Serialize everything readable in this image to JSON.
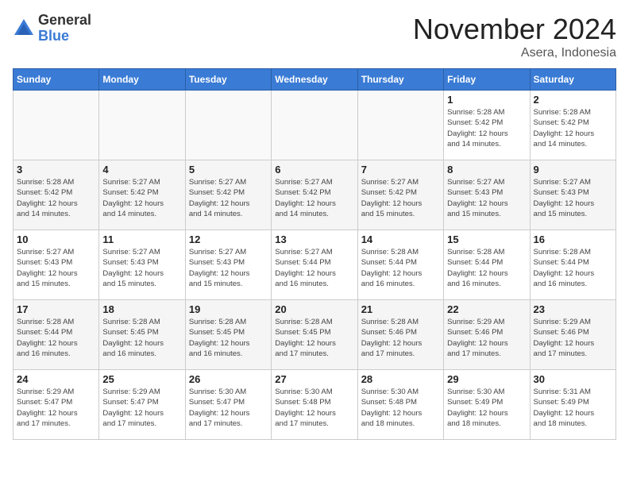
{
  "header": {
    "logo_general": "General",
    "logo_blue": "Blue",
    "month_title": "November 2024",
    "location": "Asera, Indonesia"
  },
  "days_of_week": [
    "Sunday",
    "Monday",
    "Tuesday",
    "Wednesday",
    "Thursday",
    "Friday",
    "Saturday"
  ],
  "weeks": [
    [
      {
        "day": "",
        "info": ""
      },
      {
        "day": "",
        "info": ""
      },
      {
        "day": "",
        "info": ""
      },
      {
        "day": "",
        "info": ""
      },
      {
        "day": "",
        "info": ""
      },
      {
        "day": "1",
        "info": "Sunrise: 5:28 AM\nSunset: 5:42 PM\nDaylight: 12 hours\nand 14 minutes."
      },
      {
        "day": "2",
        "info": "Sunrise: 5:28 AM\nSunset: 5:42 PM\nDaylight: 12 hours\nand 14 minutes."
      }
    ],
    [
      {
        "day": "3",
        "info": "Sunrise: 5:28 AM\nSunset: 5:42 PM\nDaylight: 12 hours\nand 14 minutes."
      },
      {
        "day": "4",
        "info": "Sunrise: 5:27 AM\nSunset: 5:42 PM\nDaylight: 12 hours\nand 14 minutes."
      },
      {
        "day": "5",
        "info": "Sunrise: 5:27 AM\nSunset: 5:42 PM\nDaylight: 12 hours\nand 14 minutes."
      },
      {
        "day": "6",
        "info": "Sunrise: 5:27 AM\nSunset: 5:42 PM\nDaylight: 12 hours\nand 14 minutes."
      },
      {
        "day": "7",
        "info": "Sunrise: 5:27 AM\nSunset: 5:42 PM\nDaylight: 12 hours\nand 15 minutes."
      },
      {
        "day": "8",
        "info": "Sunrise: 5:27 AM\nSunset: 5:43 PM\nDaylight: 12 hours\nand 15 minutes."
      },
      {
        "day": "9",
        "info": "Sunrise: 5:27 AM\nSunset: 5:43 PM\nDaylight: 12 hours\nand 15 minutes."
      }
    ],
    [
      {
        "day": "10",
        "info": "Sunrise: 5:27 AM\nSunset: 5:43 PM\nDaylight: 12 hours\nand 15 minutes."
      },
      {
        "day": "11",
        "info": "Sunrise: 5:27 AM\nSunset: 5:43 PM\nDaylight: 12 hours\nand 15 minutes."
      },
      {
        "day": "12",
        "info": "Sunrise: 5:27 AM\nSunset: 5:43 PM\nDaylight: 12 hours\nand 15 minutes."
      },
      {
        "day": "13",
        "info": "Sunrise: 5:27 AM\nSunset: 5:44 PM\nDaylight: 12 hours\nand 16 minutes."
      },
      {
        "day": "14",
        "info": "Sunrise: 5:28 AM\nSunset: 5:44 PM\nDaylight: 12 hours\nand 16 minutes."
      },
      {
        "day": "15",
        "info": "Sunrise: 5:28 AM\nSunset: 5:44 PM\nDaylight: 12 hours\nand 16 minutes."
      },
      {
        "day": "16",
        "info": "Sunrise: 5:28 AM\nSunset: 5:44 PM\nDaylight: 12 hours\nand 16 minutes."
      }
    ],
    [
      {
        "day": "17",
        "info": "Sunrise: 5:28 AM\nSunset: 5:44 PM\nDaylight: 12 hours\nand 16 minutes."
      },
      {
        "day": "18",
        "info": "Sunrise: 5:28 AM\nSunset: 5:45 PM\nDaylight: 12 hours\nand 16 minutes."
      },
      {
        "day": "19",
        "info": "Sunrise: 5:28 AM\nSunset: 5:45 PM\nDaylight: 12 hours\nand 16 minutes."
      },
      {
        "day": "20",
        "info": "Sunrise: 5:28 AM\nSunset: 5:45 PM\nDaylight: 12 hours\nand 17 minutes."
      },
      {
        "day": "21",
        "info": "Sunrise: 5:28 AM\nSunset: 5:46 PM\nDaylight: 12 hours\nand 17 minutes."
      },
      {
        "day": "22",
        "info": "Sunrise: 5:29 AM\nSunset: 5:46 PM\nDaylight: 12 hours\nand 17 minutes."
      },
      {
        "day": "23",
        "info": "Sunrise: 5:29 AM\nSunset: 5:46 PM\nDaylight: 12 hours\nand 17 minutes."
      }
    ],
    [
      {
        "day": "24",
        "info": "Sunrise: 5:29 AM\nSunset: 5:47 PM\nDaylight: 12 hours\nand 17 minutes."
      },
      {
        "day": "25",
        "info": "Sunrise: 5:29 AM\nSunset: 5:47 PM\nDaylight: 12 hours\nand 17 minutes."
      },
      {
        "day": "26",
        "info": "Sunrise: 5:30 AM\nSunset: 5:47 PM\nDaylight: 12 hours\nand 17 minutes."
      },
      {
        "day": "27",
        "info": "Sunrise: 5:30 AM\nSunset: 5:48 PM\nDaylight: 12 hours\nand 17 minutes."
      },
      {
        "day": "28",
        "info": "Sunrise: 5:30 AM\nSunset: 5:48 PM\nDaylight: 12 hours\nand 18 minutes."
      },
      {
        "day": "29",
        "info": "Sunrise: 5:30 AM\nSunset: 5:49 PM\nDaylight: 12 hours\nand 18 minutes."
      },
      {
        "day": "30",
        "info": "Sunrise: 5:31 AM\nSunset: 5:49 PM\nDaylight: 12 hours\nand 18 minutes."
      }
    ]
  ]
}
